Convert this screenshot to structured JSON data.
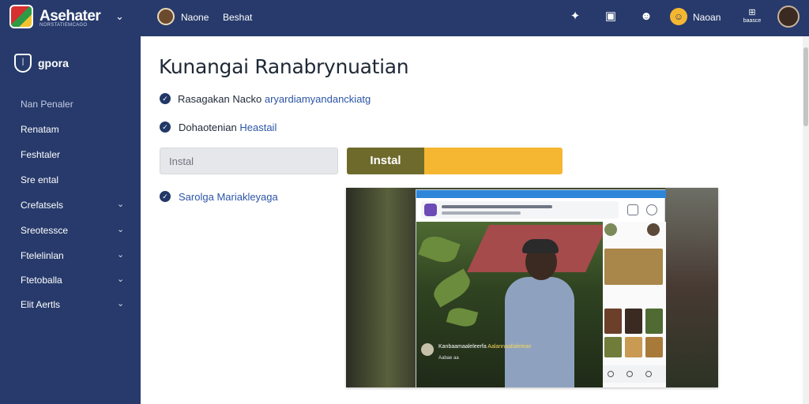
{
  "header": {
    "brand": "Asehater",
    "brand_sub": "NORSTATIEMCAGO",
    "links": [
      "Naone",
      "Beshat"
    ],
    "notification_name": "Naoan",
    "profile_label": "baasce"
  },
  "sidebar": {
    "brand": "gpora",
    "items": [
      {
        "label": "Nan Penaler",
        "chevron": false
      },
      {
        "label": "Renatam",
        "chevron": false
      },
      {
        "label": "Feshtaler",
        "chevron": false
      },
      {
        "label": "Sre ental",
        "chevron": false
      },
      {
        "label": "Crefatsels",
        "chevron": true
      },
      {
        "label": "Sreotessce",
        "chevron": true
      },
      {
        "label": "Ftelelinlan",
        "chevron": true
      },
      {
        "label": "Ftetoballa",
        "chevron": true
      },
      {
        "label": "Elit Aertls",
        "chevron": true
      }
    ]
  },
  "main": {
    "title": "Kunangai Ranabrynuatian",
    "line1": {
      "text": "Rasagakan Nacko",
      "link": "aryardiamyandanckiatg"
    },
    "line2": {
      "text": "Dohaotenian",
      "link": "Heastail"
    },
    "field_value": "Instal",
    "install_label": "Instal",
    "line3": {
      "text": "Sarolga",
      "link": "Mariakleyaga"
    }
  },
  "preview": {
    "caption_prefix": "Kanbaamaaleleerfa",
    "caption_highlight": "Aalannaallalelean",
    "caption_sub": "Aabae aa"
  },
  "colors": {
    "navy": "#273a6b",
    "accent_yellow": "#f5b731",
    "install_green": "#6e6a2c",
    "link_blue": "#2b55a6"
  }
}
